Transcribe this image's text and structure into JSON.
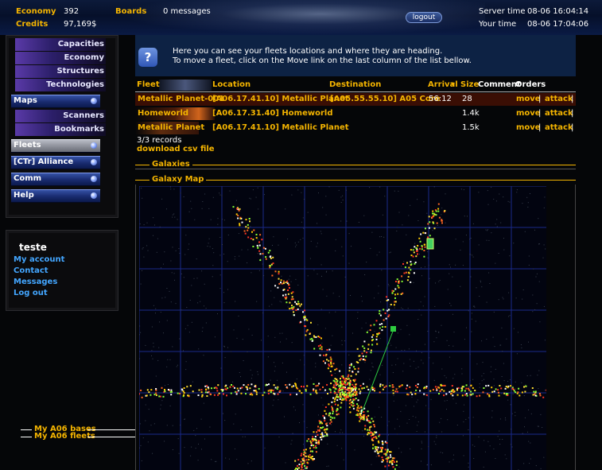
{
  "header": {
    "economy_label": "Economy",
    "economy_value": "392",
    "credits_label": "Credits",
    "credits_value": "97,169$",
    "boards_label": "Boards",
    "messages": "0 messages",
    "logout": "logout",
    "server_time_label": "Server time",
    "server_time_value": "08-06 16:04:14",
    "your_time_label": "Your time",
    "your_time_value": "08-06 17:04:06"
  },
  "nav": {
    "capacities": "Capacities",
    "economy": "Economy",
    "structures": "Structures",
    "technologies": "Technologies",
    "maps": "Maps",
    "scanners": "Scanners",
    "bookmarks": "Bookmarks",
    "fleets": "Fleets",
    "alliance": "[CTr] Alliance",
    "comm": "Comm",
    "help": "Help"
  },
  "user": {
    "name": "teste",
    "my_account": "My account",
    "contact": "Contact",
    "messages": "Messages",
    "logout": "Log out"
  },
  "bottom_links": {
    "bases": "My A06 bases",
    "fleets": "My A06 fleets"
  },
  "info": {
    "line1": "Here you can see your fleets locations and where they are heading.",
    "line2": "To move a fleet, click on the Move link on the last column of the list bellow."
  },
  "table": {
    "headers": {
      "fleet": "Fleet",
      "location": "Location",
      "destination": "Destination",
      "arrival": "Arrival",
      "size": "Size",
      "comment": "Comment",
      "orders": "Orders"
    },
    "rows": [
      {
        "fleet": "Metallic Planet-001",
        "location": "[A06.17.41.10] Metallic Planet",
        "destination": "[A05.55.55.10] A05 Core",
        "arrival": "56:12",
        "size": "28",
        "move": "move",
        "attack": "attack"
      },
      {
        "fleet": "Homeworld",
        "location": "[A06.17.31.40] Homeworld",
        "destination": "",
        "arrival": "",
        "size": "1.4k",
        "move": "move",
        "attack": "attack"
      },
      {
        "fleet": "Metallic Planet",
        "location": "[A06.17.41.10] Metallic Planet",
        "destination": "",
        "arrival": "",
        "size": "1.5k",
        "move": "move",
        "attack": "attack"
      }
    ],
    "records": "3/3 records",
    "download": "download csv file"
  },
  "sections": {
    "galaxies": "Galaxies",
    "galaxy_map": "Galaxy Map"
  },
  "colors": {
    "accent_orange": "#f4b400",
    "link_blue": "#43a6ff",
    "header_blue": "#0d2244"
  }
}
